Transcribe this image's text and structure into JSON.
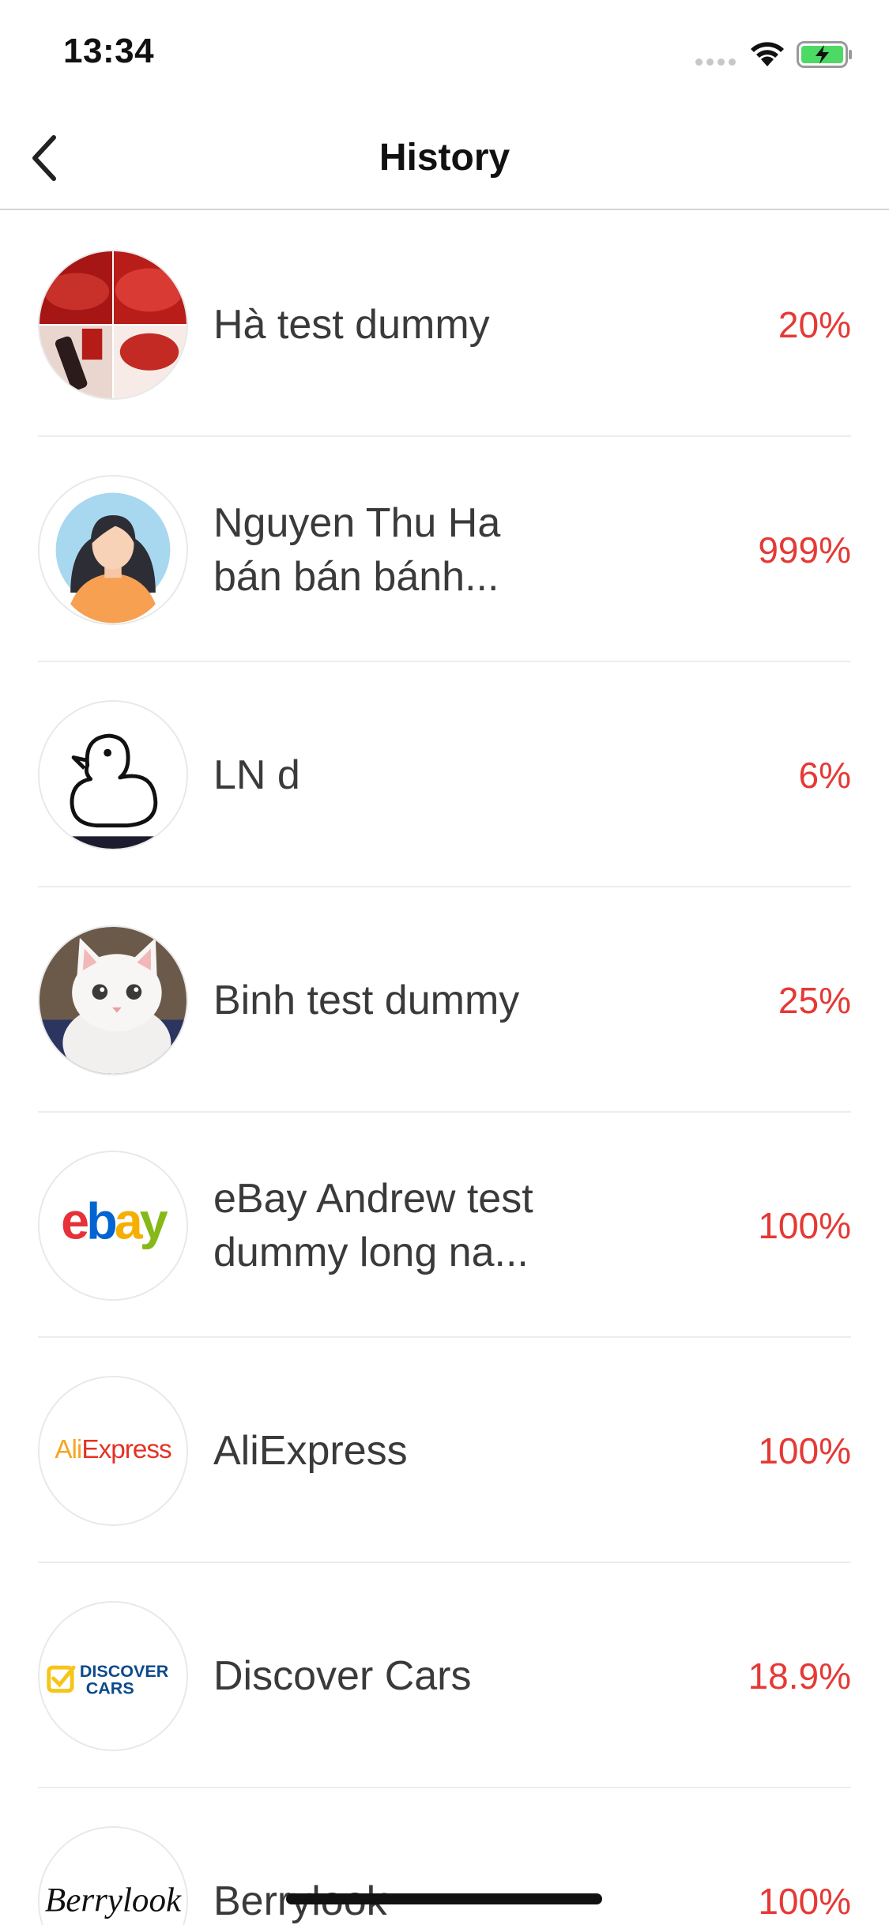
{
  "status_bar": {
    "time": "13:34",
    "icons": [
      "signal-icon",
      "wifi-icon",
      "battery-charging-icon"
    ]
  },
  "nav": {
    "back_icon": "chevron-left-icon",
    "title": "History"
  },
  "colors": {
    "percent": "#e53935",
    "text": "#3a3a3a",
    "divider": "#ededed"
  },
  "items": [
    {
      "name": "Hà test dummy",
      "percent": "20%",
      "avatar": "lipstick-photo"
    },
    {
      "name": "Nguyen Thu Ha bán bán bánh...",
      "percent": "999%",
      "avatar": "default-woman-avatar"
    },
    {
      "name": "LN d",
      "percent": "6%",
      "avatar": "duck-outline-logo"
    },
    {
      "name": "Binh test dummy",
      "percent": "25%",
      "avatar": "white-kitten-photo"
    },
    {
      "name": "eBay Andrew test dummy long na...",
      "percent": "100%",
      "avatar": "ebay-logo",
      "logo_text": "ebay"
    },
    {
      "name": "AliExpress",
      "percent": "100%",
      "avatar": "aliexpress-logo",
      "logo_text": "AliExpress"
    },
    {
      "name": "Discover Cars",
      "percent": "18.9%",
      "avatar": "discover-cars-logo",
      "logo_text": [
        "DISCOVER",
        "CARS"
      ]
    },
    {
      "name": "Berrylook",
      "percent": "100%",
      "avatar": "berrylook-logo",
      "logo_text": "Berrylook"
    }
  ]
}
